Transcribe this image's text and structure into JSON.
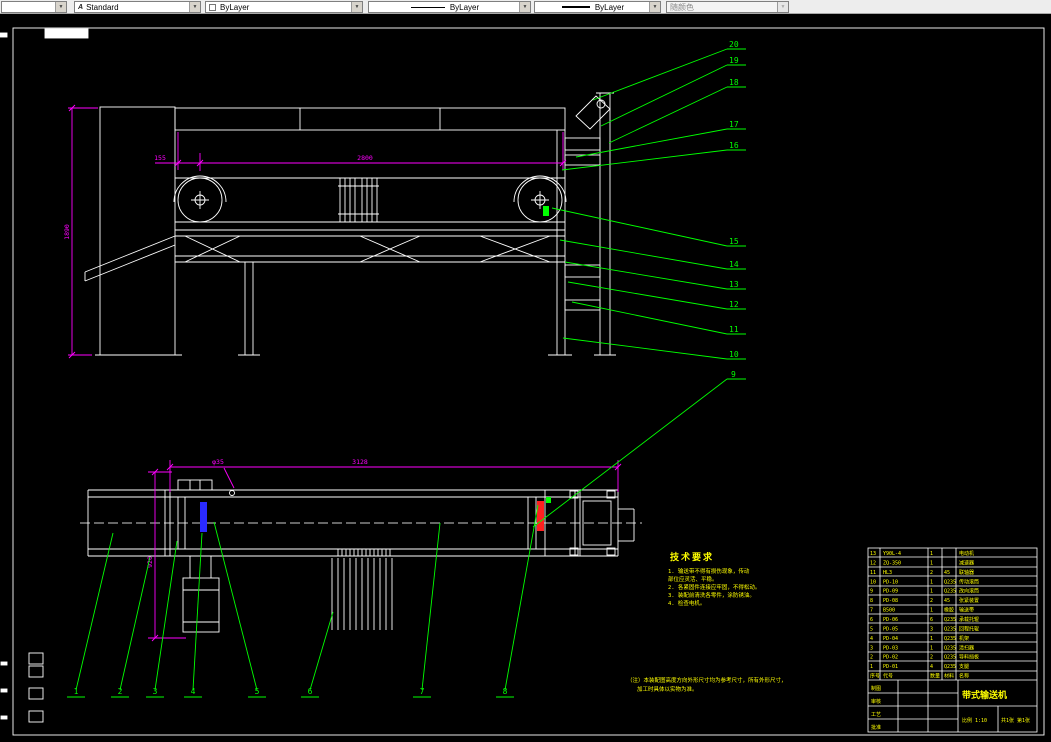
{
  "toolbar": {
    "layer_value": "",
    "style_label": "Standard",
    "color_label": "ByLayer",
    "linetype_label": "ByLayer",
    "lineweight_label": "ByLayer",
    "plotstyle_label": "随颜色"
  },
  "colors": {
    "canvas_bg": "#000000",
    "geometry": "#ffffff",
    "dimension": "#ff00ff",
    "leader": "#00ff00",
    "annotation": "#ffff00",
    "accent_blue": "#2a2aff",
    "accent_red": "#ff2020",
    "toolbar_bg": "#ededed"
  },
  "drawing": {
    "dimensions": {
      "side_offset": "155",
      "side_length": "2800",
      "side_height": "1890",
      "plan_length": "3128",
      "plan_hole": "φ35",
      "plan_width": "920"
    },
    "callouts_right": [
      "20",
      "19",
      "18",
      "17",
      "16",
      "15",
      "14",
      "13",
      "12",
      "11",
      "10",
      "9"
    ],
    "callouts_bottom": [
      "1",
      "2",
      "3",
      "4",
      "5",
      "6",
      "7",
      "8"
    ],
    "tech": {
      "title": "技术要求",
      "lines": [
        "1. 输送带不得有损伤现象，传动",
        "    部位应灵活、平稳。",
        "2. 各紧固件连接应牢固，不得松动。",
        "3. 装配前清洗各零件，涂防锈油。",
        "4. 检查电机。"
      ]
    },
    "note_lines": [
      "（注）本装配图高度方向外形尺寸均为参考尺寸，所有外形尺寸，",
      "    加工时具体以实物为准。"
    ]
  },
  "title_block": {
    "rows": [
      {
        "seq": "13",
        "code": "Y90L-4",
        "qty": "1",
        "material": "",
        "name": "电动机"
      },
      {
        "seq": "12",
        "code": "ZQ-350",
        "qty": "1",
        "material": "",
        "name": "减速器"
      },
      {
        "seq": "11",
        "code": "HL3",
        "qty": "2",
        "material": "45",
        "name": "联轴器"
      },
      {
        "seq": "10",
        "code": "PD-10",
        "qty": "1",
        "material": "Q235",
        "name": "传动滚筒"
      },
      {
        "seq": "9",
        "code": "PD-09",
        "qty": "1",
        "material": "Q235",
        "name": "改向滚筒"
      },
      {
        "seq": "8",
        "code": "PD-08",
        "qty": "2",
        "material": "45",
        "name": "张紧装置"
      },
      {
        "seq": "7",
        "code": "B500",
        "qty": "1",
        "material": "橡胶",
        "name": "输送带"
      },
      {
        "seq": "6",
        "code": "PD-06",
        "qty": "6",
        "material": "Q235",
        "name": "承载托辊"
      },
      {
        "seq": "5",
        "code": "PD-05",
        "qty": "3",
        "material": "Q235",
        "name": "回程托辊"
      },
      {
        "seq": "4",
        "code": "PD-04",
        "qty": "1",
        "material": "Q235",
        "name": "机架"
      },
      {
        "seq": "3",
        "code": "PD-03",
        "qty": "1",
        "material": "Q235",
        "name": "清扫器"
      },
      {
        "seq": "2",
        "code": "PD-02",
        "qty": "2",
        "material": "Q235",
        "name": "导料挡板"
      },
      {
        "seq": "1",
        "code": "PD-01",
        "qty": "4",
        "material": "Q235",
        "name": "支腿"
      },
      {
        "seq": "序号",
        "code": "代号",
        "qty": "数量",
        "material": "材料",
        "name": "名称"
      }
    ],
    "info": {
      "row_labels": [
        "制图",
        "审核",
        "工艺",
        "批准"
      ],
      "title": "带式输送机",
      "scale_text": "比例 1:10",
      "sheet_text": "共1张 第1张"
    }
  }
}
